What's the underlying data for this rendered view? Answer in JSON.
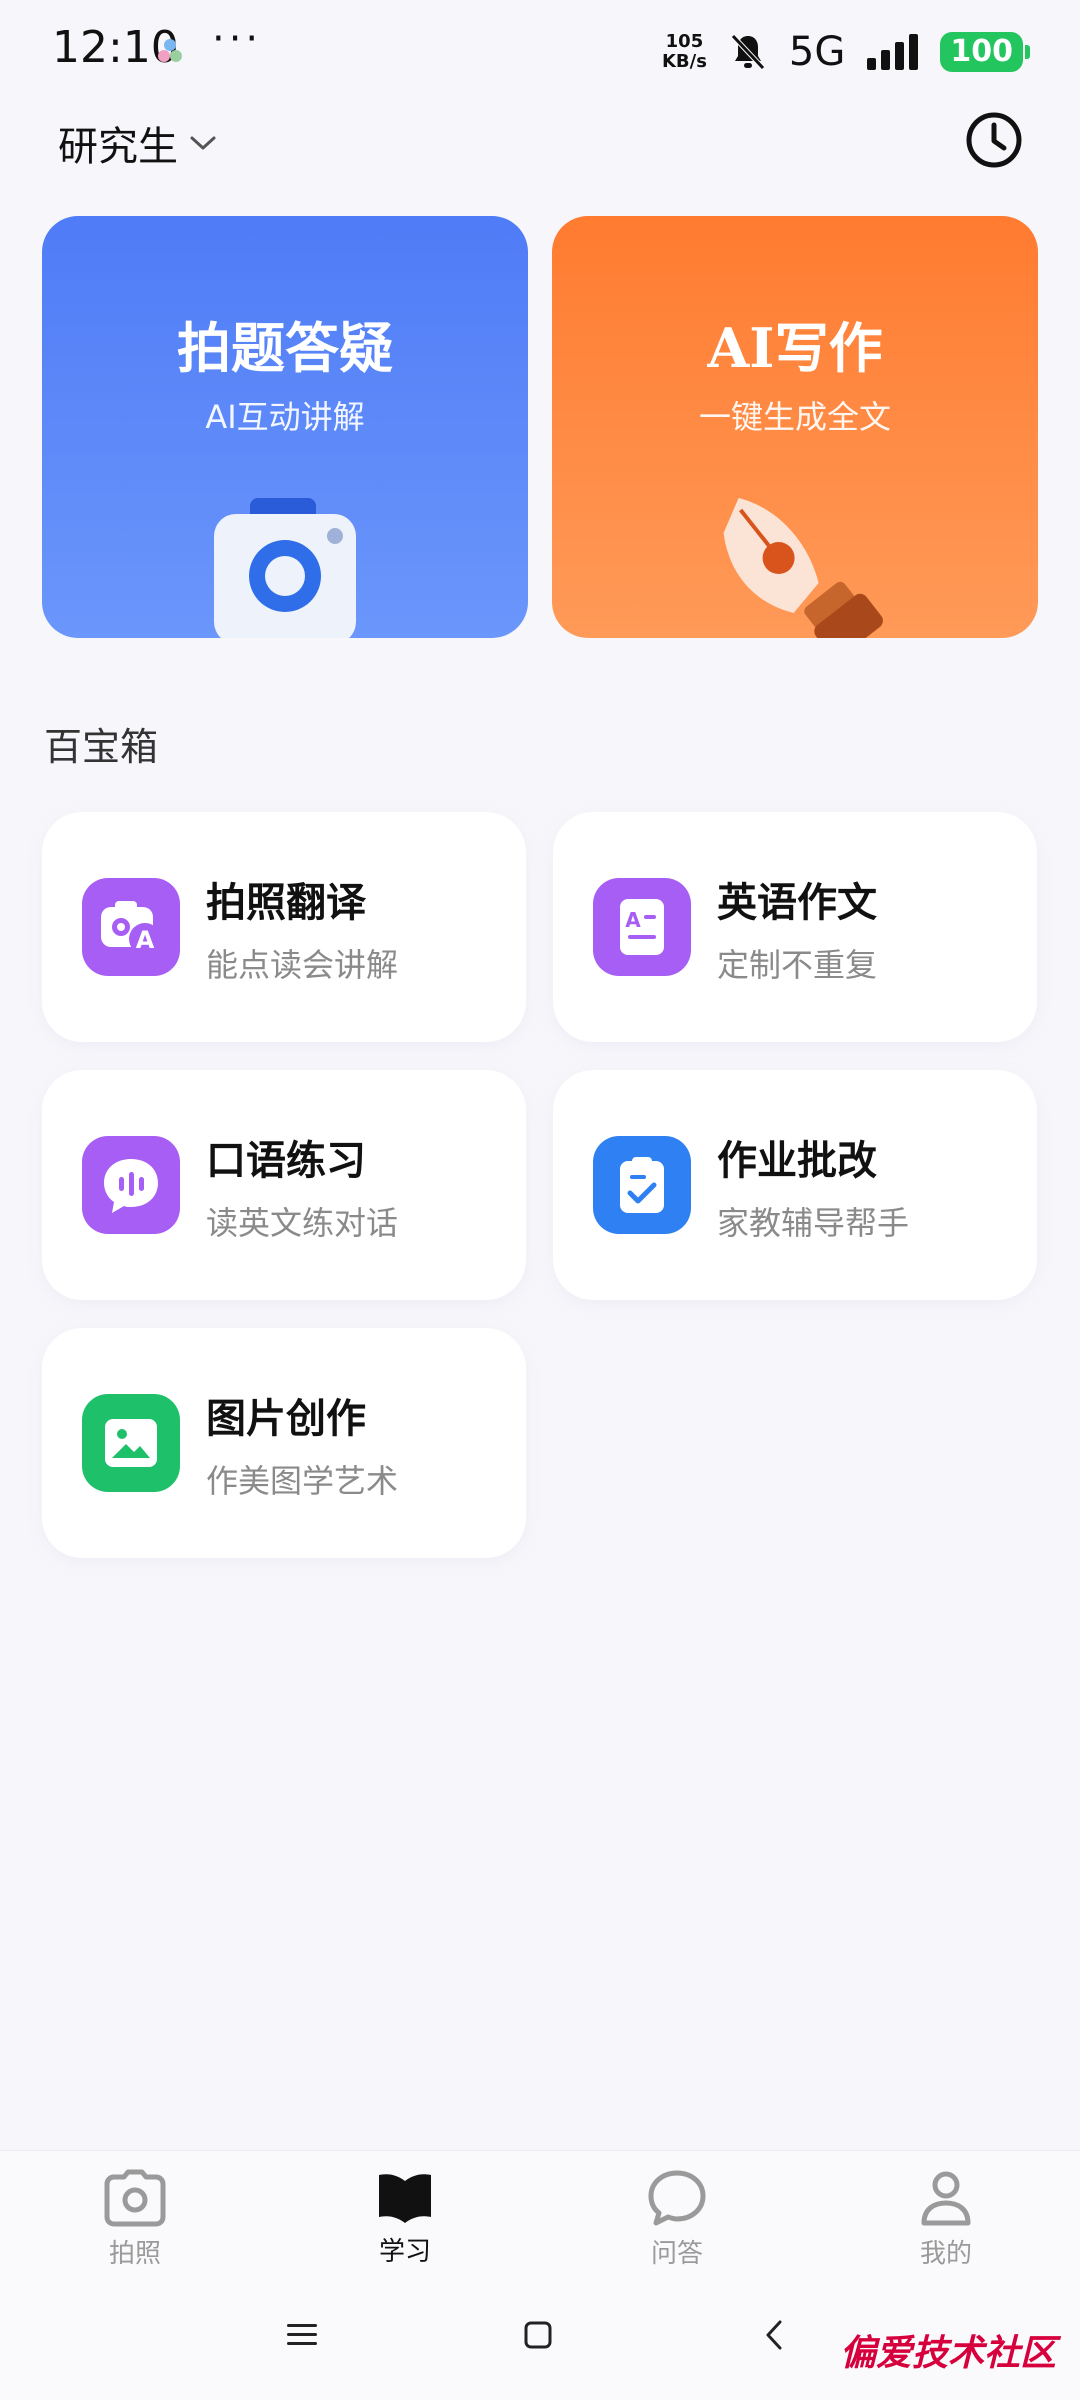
{
  "status_bar": {
    "time": "12:10",
    "dots": "···",
    "net_speed_value": "105",
    "net_speed_unit": "KB/s",
    "network": "5G",
    "battery": "100"
  },
  "header": {
    "level": "研究生",
    "history_icon": "clock-icon"
  },
  "hero": [
    {
      "title": "拍题答疑",
      "subtitle": "AI互动讲解",
      "color": "#5a86f8"
    },
    {
      "title": "AI写作",
      "subtitle": "一键生成全文",
      "color": "#ff8238"
    }
  ],
  "toolbox": {
    "title": "百宝箱",
    "items": [
      {
        "title": "拍照翻译",
        "subtitle": "能点读会讲解",
        "icon": "camera-translate-icon",
        "color": "#a65ef5"
      },
      {
        "title": "英语作文",
        "subtitle": "定制不重复",
        "icon": "document-icon",
        "color": "#a65ef5"
      },
      {
        "title": "口语练习",
        "subtitle": "读英文练对话",
        "icon": "speech-bubble-icon",
        "color": "#a65ef5"
      },
      {
        "title": "作业批改",
        "subtitle": "家教辅导帮手",
        "icon": "checklist-icon",
        "color": "#2f80f3"
      },
      {
        "title": "图片创作",
        "subtitle": "作美图学艺术",
        "icon": "image-icon",
        "color": "#1fc06a"
      }
    ]
  },
  "bottom_nav": [
    {
      "label": "拍照",
      "icon": "camera-icon",
      "active": false
    },
    {
      "label": "学习",
      "icon": "book-icon",
      "active": true
    },
    {
      "label": "问答",
      "icon": "chat-icon",
      "active": false
    },
    {
      "label": "我的",
      "icon": "person-icon",
      "active": false
    }
  ],
  "watermark": "偏爱技术社区"
}
